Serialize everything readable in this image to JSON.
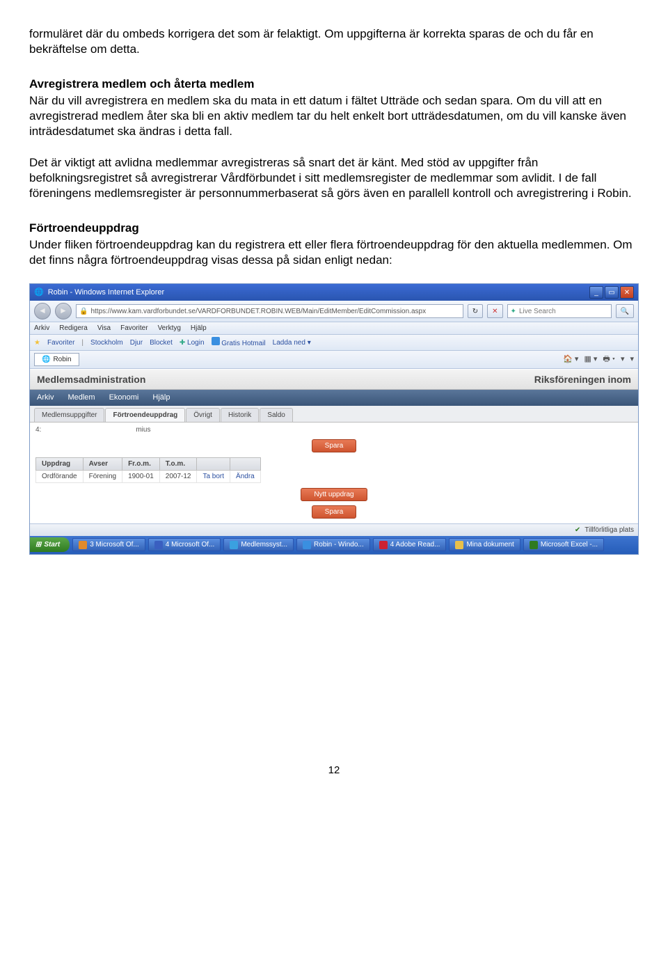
{
  "doc": {
    "intro_para": "formuläret där du ombeds korrigera det som är felaktigt. Om uppgifterna är korrekta sparas de och du får en bekräftelse om detta.",
    "sect1_title": "Avregistrera medlem och återta medlem",
    "sect1_p1": "När du vill avregistrera en medlem ska du mata in ett datum i fältet Utträde och sedan spara. Om du vill att en avregistrerad medlem åter ska bli en aktiv medlem tar du helt enkelt bort utträdesdatumen, om du vill kanske även inträdesdatumet ska ändras i detta fall.",
    "sect1_p2": "Det är viktigt att avlidna medlemmar avregistreras så snart det är känt. Med stöd av uppgifter från befolkningsregistret så avregistrerar Vårdförbundet i sitt medlemsregister de medlemmar som avlidit. I de fall föreningens medlemsregister är personnummerbaserat så görs även en parallell kontroll och avregistrering i Robin.",
    "sect2_title": "Förtroendeuppdrag",
    "sect2_p1": "Under fliken förtroendeuppdrag kan du registrera ett eller flera förtroendeuppdrag för den aktuella medlemmen. Om det finns några förtroendeuppdrag visas dessa på sidan enligt nedan:",
    "pagenum": "12"
  },
  "browser": {
    "title": "Robin - Windows Internet Explorer",
    "url": "https://www.kam.vardforbundet.se/VARDFORBUNDET.ROBIN.WEB/Main/EditMember/EditCommission.aspx",
    "search_placeholder": "Live Search",
    "menu": [
      "Arkiv",
      "Redigera",
      "Visa",
      "Favoriter",
      "Verktyg",
      "Hjälp"
    ],
    "fav_label": "Favoriter",
    "fav_items": [
      "Stockholm",
      "Djur",
      "Blocket",
      "Login",
      "Gratis Hotmail",
      "Ladda ned"
    ],
    "tab_label": "Robin",
    "status": "Tillförlitliga plats"
  },
  "app": {
    "header_left": "Medlemsadministration",
    "header_right": "Riksföreningen inom",
    "menu": [
      "Arkiv",
      "Medlem",
      "Ekonomi",
      "Hjälp"
    ],
    "subtabs": [
      "Medlemsuppgifter",
      "Förtroendeuppdrag",
      "Övrigt",
      "Historik",
      "Saldo"
    ],
    "numprefix": "4:",
    "numsuffix": "mius",
    "btn_save": "Spara",
    "btn_new": "Nytt uppdrag",
    "table_headers": [
      "Uppdrag",
      "Avser",
      "Fr.o.m.",
      "T.o.m.",
      "",
      ""
    ],
    "table_row": [
      "Ordförande",
      "Förening",
      "1900-01",
      "2007-12",
      "Ta bort",
      "Ändra"
    ]
  },
  "taskbar": {
    "start": "Start",
    "items": [
      "3 Microsoft Of...",
      "4 Microsoft Of...",
      "Medlemssyst...",
      "Robin - Windo...",
      "4 Adobe Read...",
      "Mina dokument",
      "Microsoft Excel -..."
    ]
  }
}
